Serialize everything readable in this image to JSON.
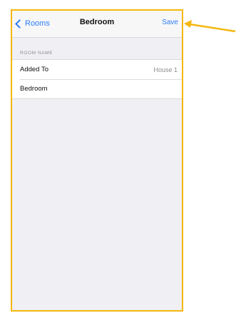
{
  "nav": {
    "back_label": "Rooms",
    "title": "Bedroom",
    "save_label": "Save"
  },
  "section": {
    "header": "ROOM NAME"
  },
  "rows": [
    {
      "label": "Added To",
      "value": "House 1"
    },
    {
      "label": "Bedroom",
      "value": ""
    }
  ],
  "colors": {
    "accent": "#2c7cf6",
    "highlight": "#f5b70f",
    "background": "#efeff4"
  }
}
